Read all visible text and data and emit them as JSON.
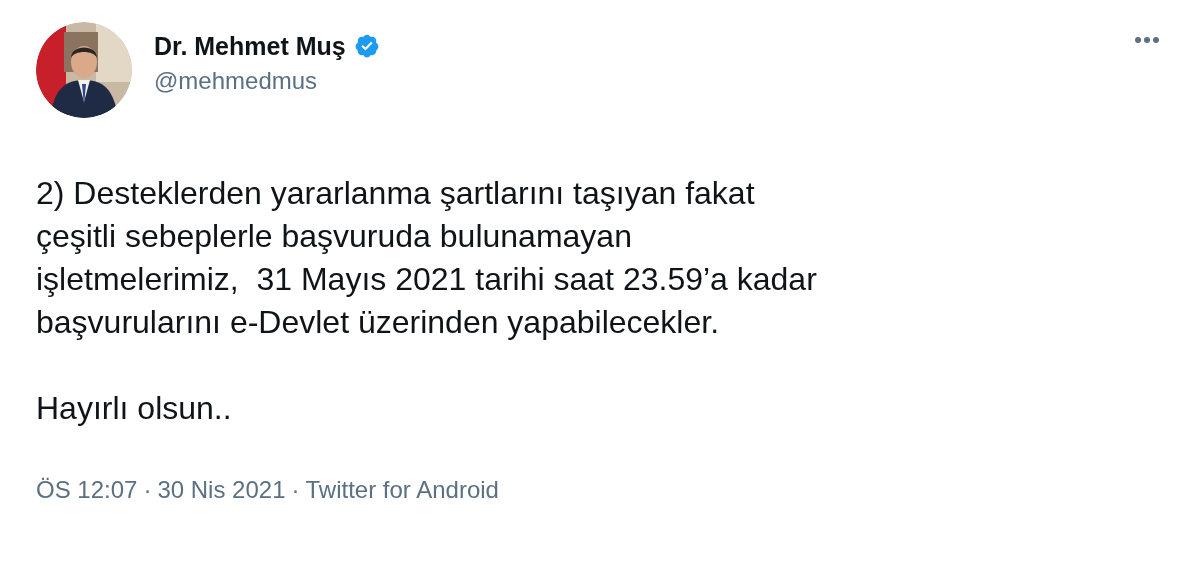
{
  "author": {
    "name": "Dr. Mehmet Muş",
    "handle": "@mehmedmus",
    "verified": true
  },
  "body": [
    [
      "2) Desteklerden yararlanma şartlarını taşıyan fakat",
      "çeşitli sebeplerle başvuruda bulunamayan",
      "işletmelerimiz,  31 Mayıs 2021 tarihi saat 23.59’a kadar",
      "başvurularını e-Devlet üzerinden yapabilecekler."
    ],
    [
      "Hayırlı olsun.."
    ]
  ],
  "footer": {
    "time": "ÖS 12:07",
    "separator": "·",
    "date": "30 Nis 2021",
    "source": "Twitter for Android"
  }
}
